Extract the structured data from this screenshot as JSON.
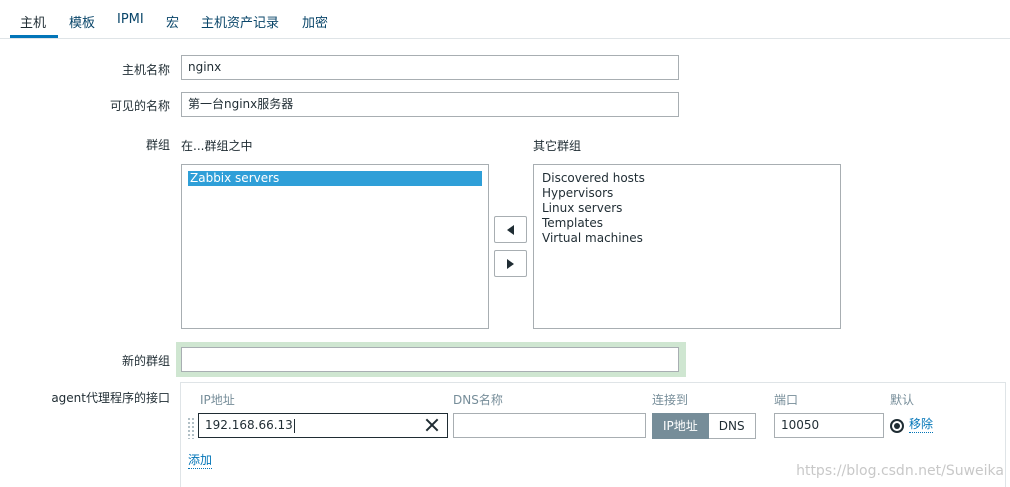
{
  "tabs": [
    {
      "label": "主机"
    },
    {
      "label": "模板"
    },
    {
      "label": "IPMI"
    },
    {
      "label": "宏"
    },
    {
      "label": "主机资产记录"
    },
    {
      "label": "加密"
    }
  ],
  "form": {
    "host_name_label": "主机名称",
    "host_name_value": "nginx",
    "visible_name_label": "可见的名称",
    "visible_name_value": "第一台nginx服务器",
    "groups_label": "群组",
    "in_groups_label": "在...群组之中",
    "other_groups_label": "其它群组",
    "in_groups": [
      "Zabbix servers"
    ],
    "other_groups": [
      "Discovered hosts",
      "Hypervisors",
      "Linux servers",
      "Templates",
      "Virtual machines"
    ],
    "new_group_label": "新的群组",
    "new_group_value": "",
    "agent_interface_label": "agent代理程序的接口"
  },
  "interface": {
    "col_ip": "IP地址",
    "col_dns": "DNS名称",
    "col_connect": "连接到",
    "col_port": "端口",
    "col_default": "默认",
    "ip_value": "192.168.66.13",
    "dns_value": "",
    "connect_ip_label": "IP地址",
    "connect_dns_label": "DNS",
    "port_value": "10050",
    "remove_label": "移除",
    "add_label": "添加"
  },
  "watermark": "https://blog.csdn.net/Suweika"
}
